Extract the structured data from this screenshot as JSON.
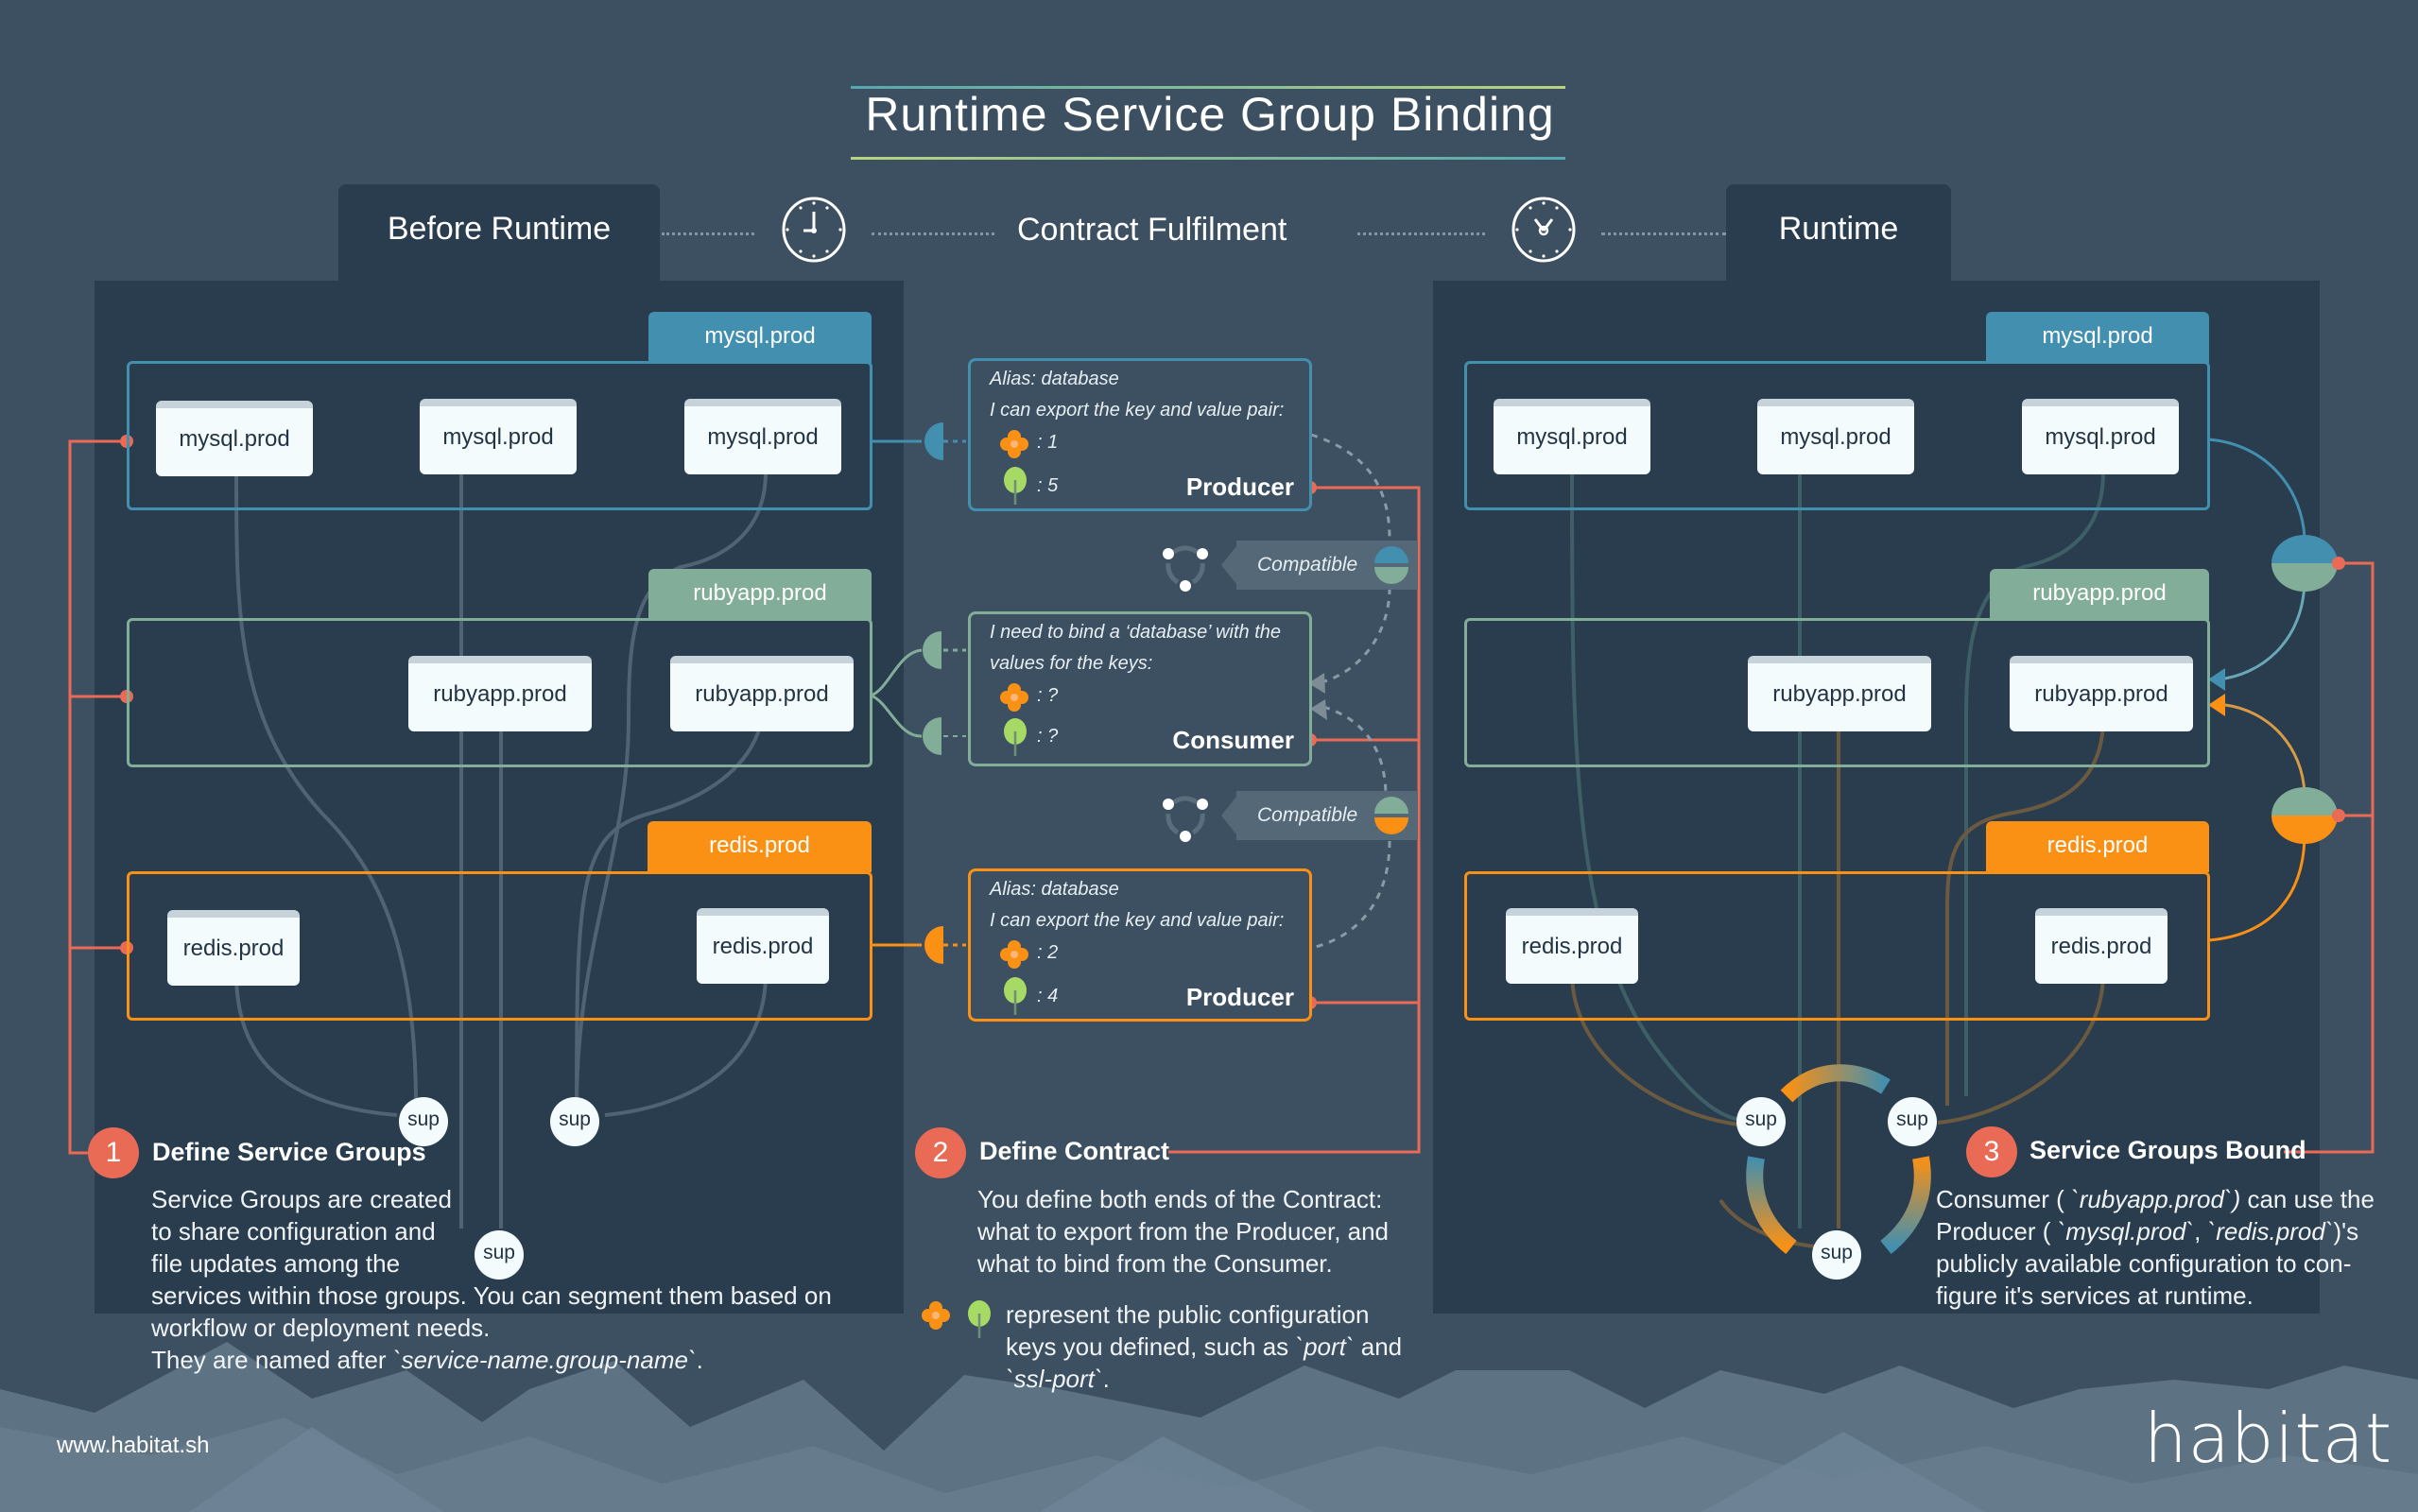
{
  "title": "Runtime Service Group Binding",
  "phases": {
    "before": "Before Runtime",
    "contract": "Contract Fulfilment",
    "runtime": "Runtime"
  },
  "icons": {
    "clock1": "clock-icon",
    "clock2": "clock-icon",
    "flower": "flower-key-icon",
    "leaf": "leaf-key-icon",
    "compatible": "compatible-cycle-icon"
  },
  "colors": {
    "background": "#3d5061",
    "panel": "#2a3d4f",
    "mysql": "#428faf",
    "rubyapp": "#82ad98",
    "redis": "#fa9114",
    "accent_red": "#e96a55"
  },
  "before_runtime": {
    "groups": [
      {
        "tab": "mysql.prod",
        "services": [
          "mysql.prod",
          "mysql.prod",
          "mysql.prod"
        ]
      },
      {
        "tab": "rubyapp.prod",
        "services": [
          "rubyapp.prod",
          "rubyapp.prod"
        ]
      },
      {
        "tab": "redis.prod",
        "services": [
          "redis.prod",
          "redis.prod"
        ]
      }
    ],
    "sups": [
      "sup",
      "sup",
      "sup"
    ]
  },
  "runtime": {
    "groups": [
      {
        "tab": "mysql.prod",
        "services": [
          "mysql.prod",
          "mysql.prod",
          "mysql.prod"
        ]
      },
      {
        "tab": "rubyapp.prod",
        "services": [
          "rubyapp.prod",
          "rubyapp.prod"
        ]
      },
      {
        "tab": "redis.prod",
        "services": [
          "redis.prod",
          "redis.prod"
        ]
      }
    ],
    "sups": [
      "sup",
      "sup",
      "sup"
    ]
  },
  "contracts": [
    {
      "lines": [
        "Alias: database",
        "I can export the key and value pair:"
      ],
      "keys": [
        ": 1",
        ": 5"
      ],
      "role": "Producer"
    },
    {
      "lines": [
        "I need to bind a ‘database’ with the",
        "values for the keys:"
      ],
      "keys": [
        ":  ?",
        ":  ?"
      ],
      "role": "Consumer"
    },
    {
      "lines": [
        "Alias: database",
        "I can export the key and value pair:"
      ],
      "keys": [
        ": 2",
        ": 4"
      ],
      "role": "Producer"
    }
  ],
  "compatible": [
    "Compatible",
    "Compatible"
  ],
  "steps": [
    {
      "num": "1",
      "title": "Define Service Groups",
      "body": [
        "Service Groups are created",
        "to share configuration and",
        "file updates among the",
        "services within those groups. You can segment them based on",
        "workflow or deployment needs."
      ],
      "named_prefix": "They are named after ",
      "named_code": "`service-name.group-name`",
      "named_suffix": "."
    },
    {
      "num": "2",
      "title": "Define Contract",
      "body": [
        "You define both ends of the Contract:",
        "what to export from the Producer, and",
        "what to bind from the Consumer."
      ],
      "legend_line1": "represent the public configuration",
      "legend_line2_prefix": "keys you defined, such as ",
      "legend_code1": "`port`",
      "legend_mid": " and",
      "legend_code2": "`ssl-port`",
      "legend_suffix": "."
    },
    {
      "num": "3",
      "title": "Service Groups Bound",
      "line1_prefix": "Consumer ( ",
      "line1_code": "`rubyapp.prod`)",
      "line1_suffix": " can use the",
      "line2_prefix": "Producer ( ",
      "line2_code1": "`mysql.prod`",
      "line2_mid": ",  ",
      "line2_code2": "`redis.prod`",
      "line2_suffix": ")'s",
      "line3": "publicly available configuration to con-",
      "line4": "figure it's services at runtime."
    }
  ],
  "footer": {
    "url": "www.habitat.sh",
    "logo": "habitat"
  }
}
